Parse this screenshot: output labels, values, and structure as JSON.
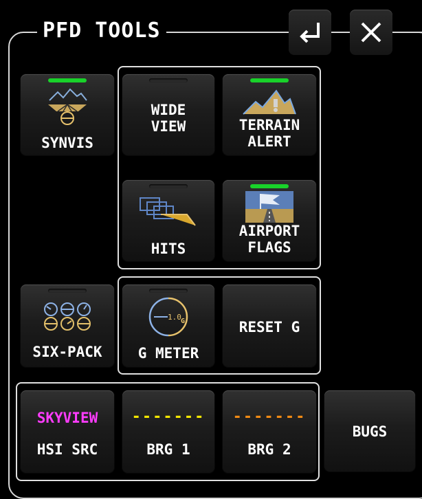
{
  "header": {
    "title": "PFD TOOLS"
  },
  "toolbar": {
    "enter_icon": "return-arrow-icon",
    "close_icon": "close-x-icon"
  },
  "colors": {
    "indicator_on": "#19d22a",
    "skyview": "#ff3cff",
    "brg1": "#f2e600",
    "brg2": "#f08a14"
  },
  "buttons": {
    "synvis": {
      "label": "SYNVIS",
      "active": true,
      "icon": "synthetic-vision-icon"
    },
    "wide_view": {
      "label": "WIDE\nVIEW",
      "active": false
    },
    "terrain_alert": {
      "label": "TERRAIN\nALERT",
      "active": true,
      "icon": "terrain-alert-icon"
    },
    "hits": {
      "label": "HITS",
      "active": false,
      "icon": "highway-in-the-sky-icon"
    },
    "airport_flags": {
      "label": "AIRPORT\nFLAGS",
      "active": true,
      "icon": "airport-flag-icon"
    },
    "six_pack": {
      "label": "SIX-PACK",
      "active": false,
      "icon": "six-pack-gauges-icon"
    },
    "g_meter": {
      "label": "G METER",
      "active": false,
      "icon": "g-meter-icon",
      "gauge_text": "1.0"
    },
    "reset_g": {
      "label": "RESET G"
    },
    "hsi_src": {
      "value": "SKYVIEW",
      "label": "HSI SRC"
    },
    "brg1": {
      "value": "-------",
      "label": "BRG 1"
    },
    "brg2": {
      "value": "-------",
      "label": "BRG 2"
    },
    "bugs": {
      "label": "BUGS"
    }
  }
}
